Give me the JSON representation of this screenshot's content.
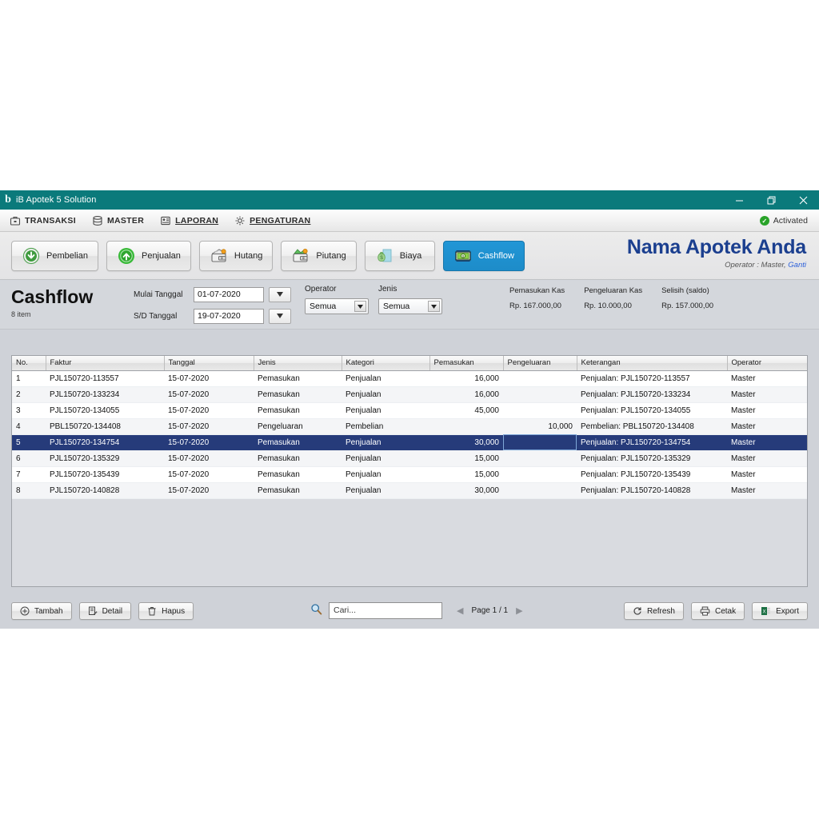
{
  "window": {
    "title": "iB Apotek 5 Solution",
    "logo_glyph": "b",
    "minimize": "–",
    "maximize": "❐",
    "close": "✕"
  },
  "menubar": {
    "items": [
      {
        "label": "TRANSAKSI",
        "icon": "briefcase-icon"
      },
      {
        "label": "MASTER",
        "icon": "database-icon"
      },
      {
        "label": "LAPORAN",
        "icon": "report-icon"
      },
      {
        "label": "PENGATURAN",
        "icon": "gear-icon"
      }
    ],
    "activated_label": "Activated",
    "activated_check": "✓"
  },
  "modules": [
    {
      "label": "Pembelian",
      "icon": "arrow-down-circle-icon",
      "active": false
    },
    {
      "label": "Penjualan",
      "icon": "arrow-up-circle-icon",
      "active": false
    },
    {
      "label": "Hutang",
      "icon": "wallet-out-icon",
      "active": false
    },
    {
      "label": "Piutang",
      "icon": "wallet-in-icon",
      "active": false
    },
    {
      "label": "Biaya",
      "icon": "money-bag-icon",
      "active": false
    },
    {
      "label": "Cashflow",
      "icon": "banknote-icon",
      "active": true
    }
  ],
  "brand": {
    "title": "Nama Apotek Anda",
    "operator_prefix": "Operator : Master,",
    "operator_change": "Ganti",
    "accent_color": "#1b3f8f"
  },
  "filters": {
    "page_title": "Cashflow",
    "item_count": "8 item",
    "start_label": "Mulai Tanggal",
    "start_value": "01-07-2020",
    "end_label": "S/D Tanggal",
    "end_value": "19-07-2020",
    "operator_label": "Operator",
    "operator_value": "Semua",
    "jenis_label": "Jenis",
    "jenis_value": "Semua",
    "dropdown_glyph": "▼"
  },
  "summary": [
    {
      "label": "Pemasukan Kas",
      "value": "Rp. 167.000,00"
    },
    {
      "label": "Pengeluaran Kas",
      "value": "Rp. 10.000,00"
    },
    {
      "label": "Selisih (saldo)",
      "value": "Rp. 157.000,00"
    }
  ],
  "table": {
    "columns": [
      "No.",
      "Faktur",
      "Tanggal",
      "Jenis",
      "Kategori",
      "Pemasukan",
      "Pengeluaran",
      "Keterangan",
      "Operator"
    ],
    "selected_row_index": 4,
    "rows": [
      {
        "no": "1",
        "faktur": "PJL150720-113557",
        "tanggal": "15-07-2020",
        "jenis": "Pemasukan",
        "kategori": "Penjualan",
        "pemasukan": "16,000",
        "pengeluaran": "",
        "keterangan": "Penjualan: PJL150720-113557",
        "operator": "Master"
      },
      {
        "no": "2",
        "faktur": "PJL150720-133234",
        "tanggal": "15-07-2020",
        "jenis": "Pemasukan",
        "kategori": "Penjualan",
        "pemasukan": "16,000",
        "pengeluaran": "",
        "keterangan": "Penjualan: PJL150720-133234",
        "operator": "Master"
      },
      {
        "no": "3",
        "faktur": "PJL150720-134055",
        "tanggal": "15-07-2020",
        "jenis": "Pemasukan",
        "kategori": "Penjualan",
        "pemasukan": "45,000",
        "pengeluaran": "",
        "keterangan": "Penjualan: PJL150720-134055",
        "operator": "Master"
      },
      {
        "no": "4",
        "faktur": "PBL150720-134408",
        "tanggal": "15-07-2020",
        "jenis": "Pengeluaran",
        "kategori": "Pembelian",
        "pemasukan": "",
        "pengeluaran": "10,000",
        "keterangan": "Pembelian: PBL150720-134408",
        "operator": "Master"
      },
      {
        "no": "5",
        "faktur": "PJL150720-134754",
        "tanggal": "15-07-2020",
        "jenis": "Pemasukan",
        "kategori": "Penjualan",
        "pemasukan": "30,000",
        "pengeluaran": "",
        "keterangan": "Penjualan: PJL150720-134754",
        "operator": "Master"
      },
      {
        "no": "6",
        "faktur": "PJL150720-135329",
        "tanggal": "15-07-2020",
        "jenis": "Pemasukan",
        "kategori": "Penjualan",
        "pemasukan": "15,000",
        "pengeluaran": "",
        "keterangan": "Penjualan: PJL150720-135329",
        "operator": "Master"
      },
      {
        "no": "7",
        "faktur": "PJL150720-135439",
        "tanggal": "15-07-2020",
        "jenis": "Pemasukan",
        "kategori": "Penjualan",
        "pemasukan": "15,000",
        "pengeluaran": "",
        "keterangan": "Penjualan: PJL150720-135439",
        "operator": "Master"
      },
      {
        "no": "8",
        "faktur": "PJL150720-140828",
        "tanggal": "15-07-2020",
        "jenis": "Pemasukan",
        "kategori": "Penjualan",
        "pemasukan": "30,000",
        "pengeluaran": "",
        "keterangan": "Penjualan: PJL150720-140828",
        "operator": "Master"
      }
    ]
  },
  "bottom": {
    "add_label": "Tambah",
    "detail_label": "Detail",
    "delete_label": "Hapus",
    "search_placeholder": "Cari...",
    "page_label": "Page 1 / 1",
    "prev_glyph": "◀",
    "next_glyph": "▶",
    "refresh_label": "Refresh",
    "print_label": "Cetak",
    "export_label": "Export"
  }
}
